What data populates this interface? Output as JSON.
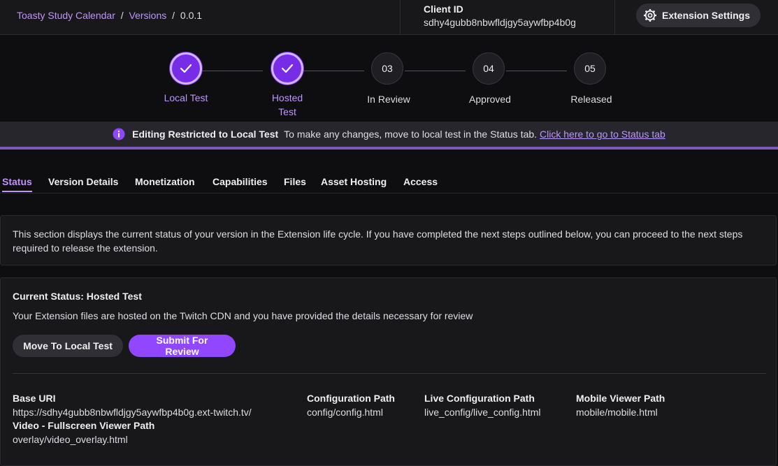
{
  "breadcrumb": {
    "app": "Toasty Study Calendar",
    "sep1": "/",
    "versions": "Versions",
    "sep2": "/",
    "version": "0.0.1"
  },
  "client": {
    "label": "Client ID",
    "id": "sdhy4gubb8nbwfldjgy5aywfbp4b0g"
  },
  "settings_button": {
    "label": "Extension Settings",
    "icon": "gear-icon"
  },
  "steps": [
    {
      "label": "Local Test",
      "state": "done"
    },
    {
      "label": "Hosted Test",
      "state": "done"
    },
    {
      "number": "03",
      "label": "In Review",
      "state": "todo"
    },
    {
      "number": "04",
      "label": "Approved",
      "state": "todo"
    },
    {
      "number": "05",
      "label": "Released",
      "state": "todo"
    }
  ],
  "banner": {
    "title": "Editing Restricted to Local Test",
    "message": "To make any changes, move to local test in the Status tab.",
    "link": "Click here to go to Status tab"
  },
  "tabs": [
    "Status",
    "Version Details",
    "Monetization",
    "Capabilities",
    "Files",
    "Asset Hosting",
    "Access"
  ],
  "active_tab": "Status",
  "description": "This section displays the current status of your version in the Extension life cycle. If you have completed the next steps outlined below, you can proceed to the next steps required to release the extension.",
  "status": {
    "title": "Current Status: Hosted Test",
    "description": "Your Extension files are hosted on the Twitch CDN and you have provided the details necessary for review",
    "move_button": "Move To Local Test",
    "submit_button": "Submit For Review"
  },
  "paths": {
    "base_uri": {
      "label": "Base URI",
      "value": "https://sdhy4gubb8nbwfldjgy5aywfbp4b0g.ext-twitch.tv/"
    },
    "config": {
      "label": "Configuration Path",
      "value": "config/config.html"
    },
    "live_config": {
      "label": "Live Configuration Path",
      "value": "live_config/live_config.html"
    },
    "mobile": {
      "label": "Mobile Viewer Path",
      "value": "mobile/mobile.html"
    },
    "video_fullscreen": {
      "label": "Video - Fullscreen Viewer Path",
      "value": "overlay/video_overlay.html"
    }
  },
  "colors": {
    "accent": "#9147ff",
    "accent_light": "#bf94ff",
    "background": "#0e0e10",
    "panel": "#18181b"
  }
}
